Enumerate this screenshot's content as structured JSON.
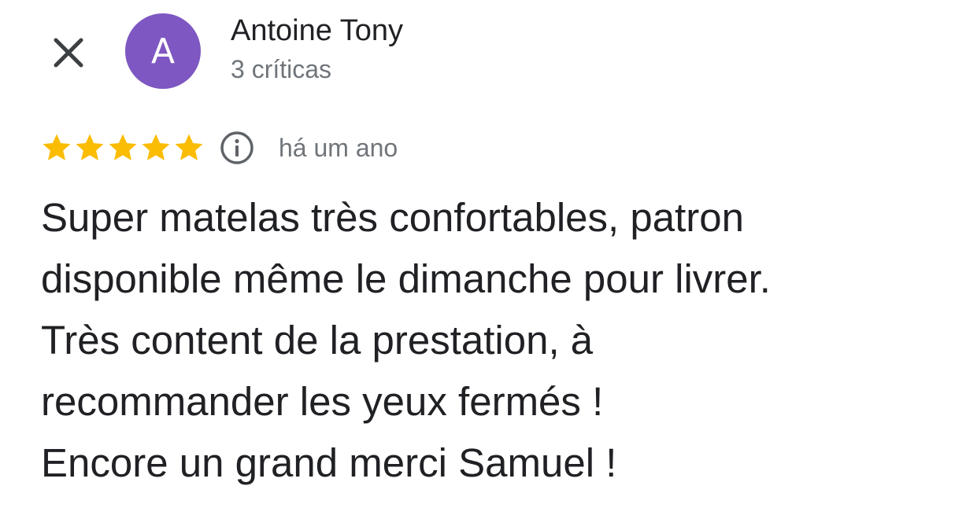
{
  "header": {
    "close_icon": "close-icon",
    "avatar_letter": "A",
    "avatar_color": "#7e57c2",
    "user_name": "Antoine Tony",
    "user_meta": "3 críticas"
  },
  "rating": {
    "stars": 5,
    "max_stars": 5,
    "star_color": "#fbbc04",
    "info_icon": "info-icon",
    "time": "há um ano"
  },
  "review": {
    "text": "Super matelas très confortables, patron\ndisponible même le dimanche pour livrer.\nTrès content de la prestation, à\nrecommander les yeux fermés !\nEncore un grand merci Samuel  !"
  }
}
